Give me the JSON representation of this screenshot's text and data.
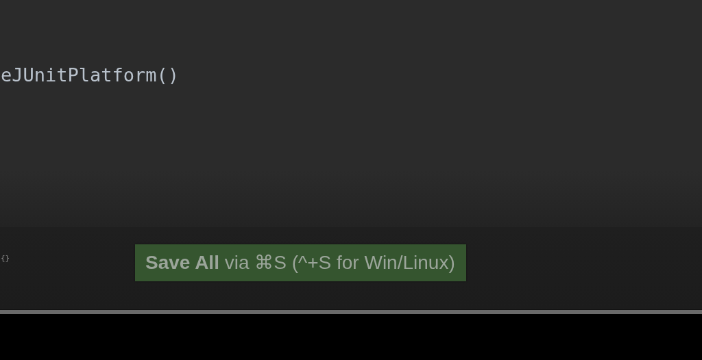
{
  "editor": {
    "lines": [
      "eJUnitPlatform()"
    ]
  },
  "breadcrumb": "{}",
  "toast": {
    "text": "**Save All** via ⌘S (^+S for Win/Linux)"
  }
}
